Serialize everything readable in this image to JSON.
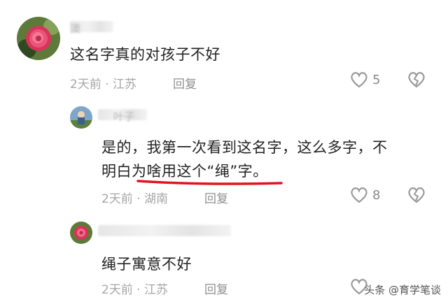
{
  "comments": [
    {
      "username": "澳",
      "text": "这名字真的对孩子不好",
      "meta": "2天前 · 江苏",
      "reply_label": "回复",
      "likes": "5"
    },
    {
      "username": "叶子",
      "text_line1": "是的，我第一次看到这名字，这么多字，不",
      "text_line2": "明白为啥用这个“绳”字。",
      "meta": "2天前 · 湖南",
      "reply_label": "回复",
      "likes": "8"
    },
    {
      "username": "",
      "text": "绳子寓意不好",
      "meta": "2天前 · 江苏",
      "reply_label": "回复"
    }
  ],
  "watermark": "头条 @育学笔谈",
  "colors": {
    "underline": "#e0151f",
    "icon": "#9a9a9a"
  }
}
